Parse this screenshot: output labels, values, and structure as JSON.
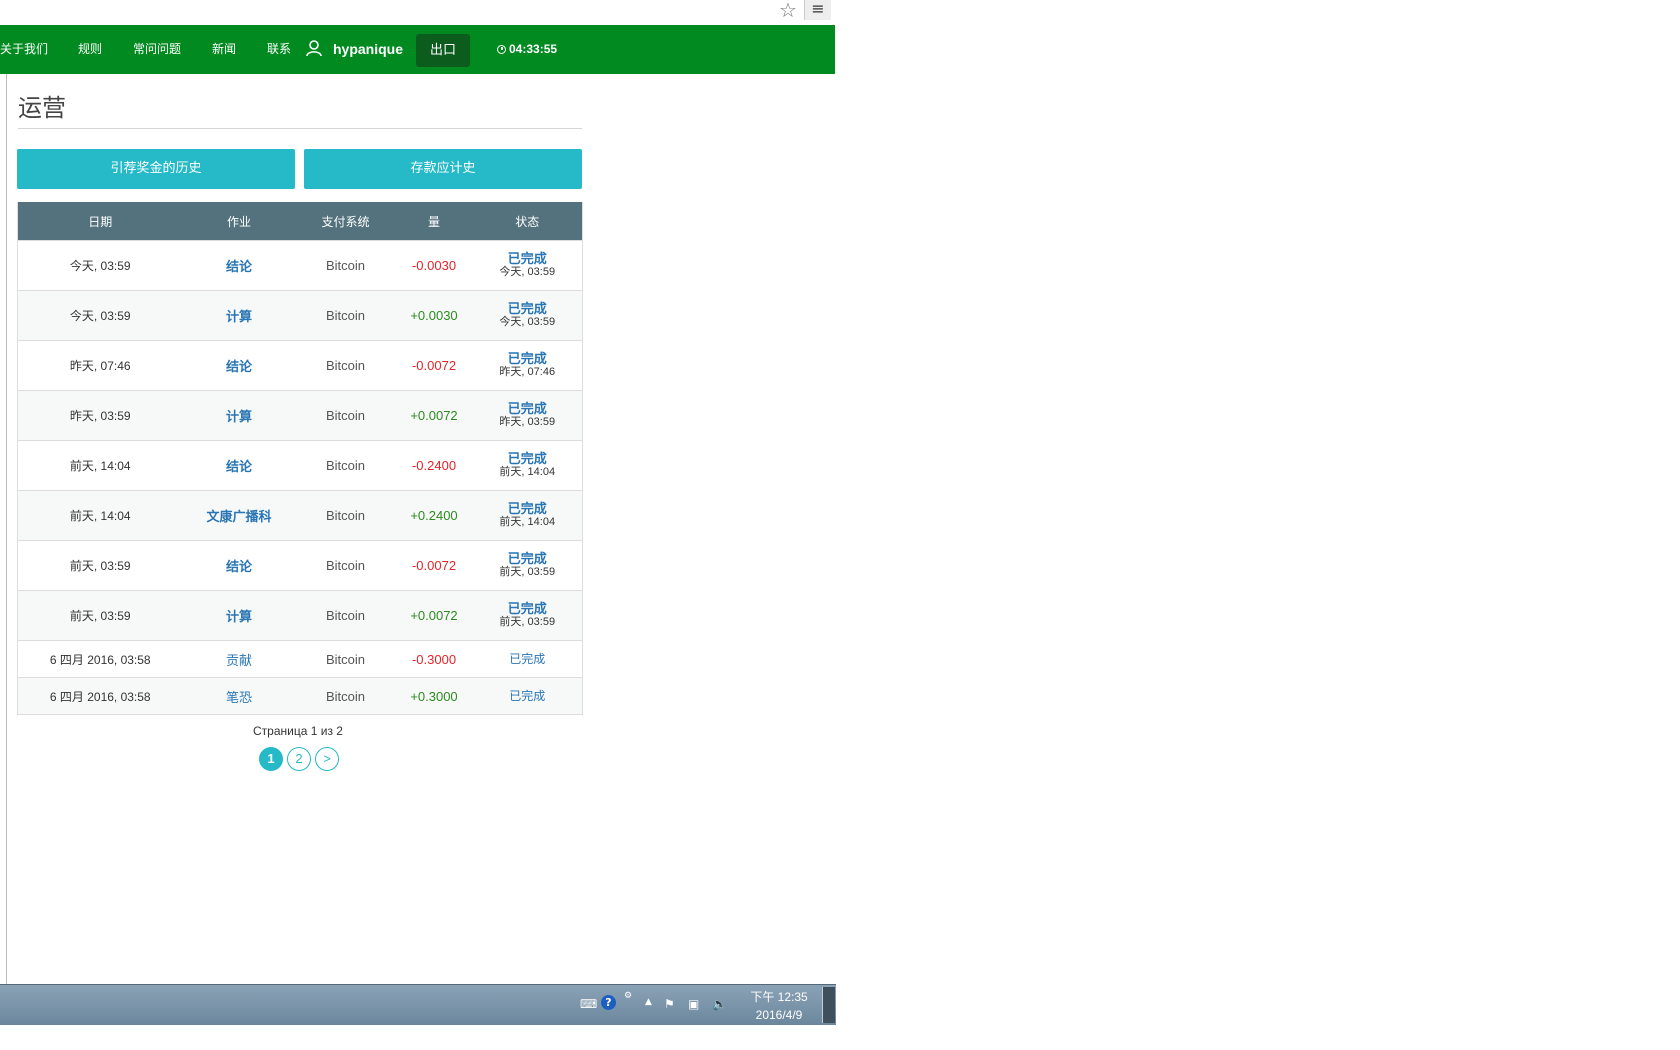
{
  "nav": {
    "items": [
      "关于我们",
      "规则",
      "常问问题",
      "新闻",
      "联系"
    ],
    "username": "hypanique",
    "logout_label": "出口",
    "time": "04:33:55"
  },
  "page": {
    "title": "运营",
    "buttons": [
      "引荐奖金的历史",
      "存款应计史"
    ]
  },
  "table": {
    "headers": [
      "日期",
      "作业",
      "支付系统",
      "量",
      "状态"
    ],
    "rows": [
      {
        "date": "今天, 03:59",
        "op": "结论",
        "sys": "Bitcoin",
        "amount": "-0.0030",
        "status": "已完成",
        "status_time": "今天, 03:59"
      },
      {
        "date": "今天, 03:59",
        "op": "计算",
        "sys": "Bitcoin",
        "amount": "+0.0030",
        "status": "已完成",
        "status_time": "今天, 03:59"
      },
      {
        "date": "昨天, 07:46",
        "op": "结论",
        "sys": "Bitcoin",
        "amount": "-0.0072",
        "status": "已完成",
        "status_time": "昨天, 07:46"
      },
      {
        "date": "昨天, 03:59",
        "op": "计算",
        "sys": "Bitcoin",
        "amount": "+0.0072",
        "status": "已完成",
        "status_time": "昨天, 03:59"
      },
      {
        "date": "前天, 14:04",
        "op": "结论",
        "sys": "Bitcoin",
        "amount": "-0.2400",
        "status": "已完成",
        "status_time": "前天, 14:04"
      },
      {
        "date": "前天, 14:04",
        "op": "文康广播科",
        "sys": "Bitcoin",
        "amount": "+0.2400",
        "status": "已完成",
        "status_time": "前天, 14:04"
      },
      {
        "date": "前天, 03:59",
        "op": "结论",
        "sys": "Bitcoin",
        "amount": "-0.0072",
        "status": "已完成",
        "status_time": "前天, 03:59"
      },
      {
        "date": "前天, 03:59",
        "op": "计算",
        "sys": "Bitcoin",
        "amount": "+0.0072",
        "status": "已完成",
        "status_time": "前天, 03:59"
      },
      {
        "date": "6 四月 2016, 03:58",
        "op": "贡献",
        "sys": "Bitcoin",
        "amount": "-0.3000",
        "status": "已完成",
        "status_time": ""
      },
      {
        "date": "6 四月 2016, 03:58",
        "op": "笔恐",
        "sys": "Bitcoin",
        "amount": "+0.3000",
        "status": "已完成",
        "status_time": ""
      }
    ]
  },
  "pagination": {
    "text": "Страница 1 из 2",
    "pages": [
      "1",
      "2",
      ">"
    ]
  },
  "taskbar": {
    "time": "下午 12:35",
    "date": "2016/4/9"
  },
  "colors": {
    "nav_green": "#008a1f",
    "teal": "#26bac8",
    "table_header": "#53727d",
    "negative": "#e0252b",
    "positive": "#2c8b1f",
    "link_blue": "#2a76b5"
  }
}
